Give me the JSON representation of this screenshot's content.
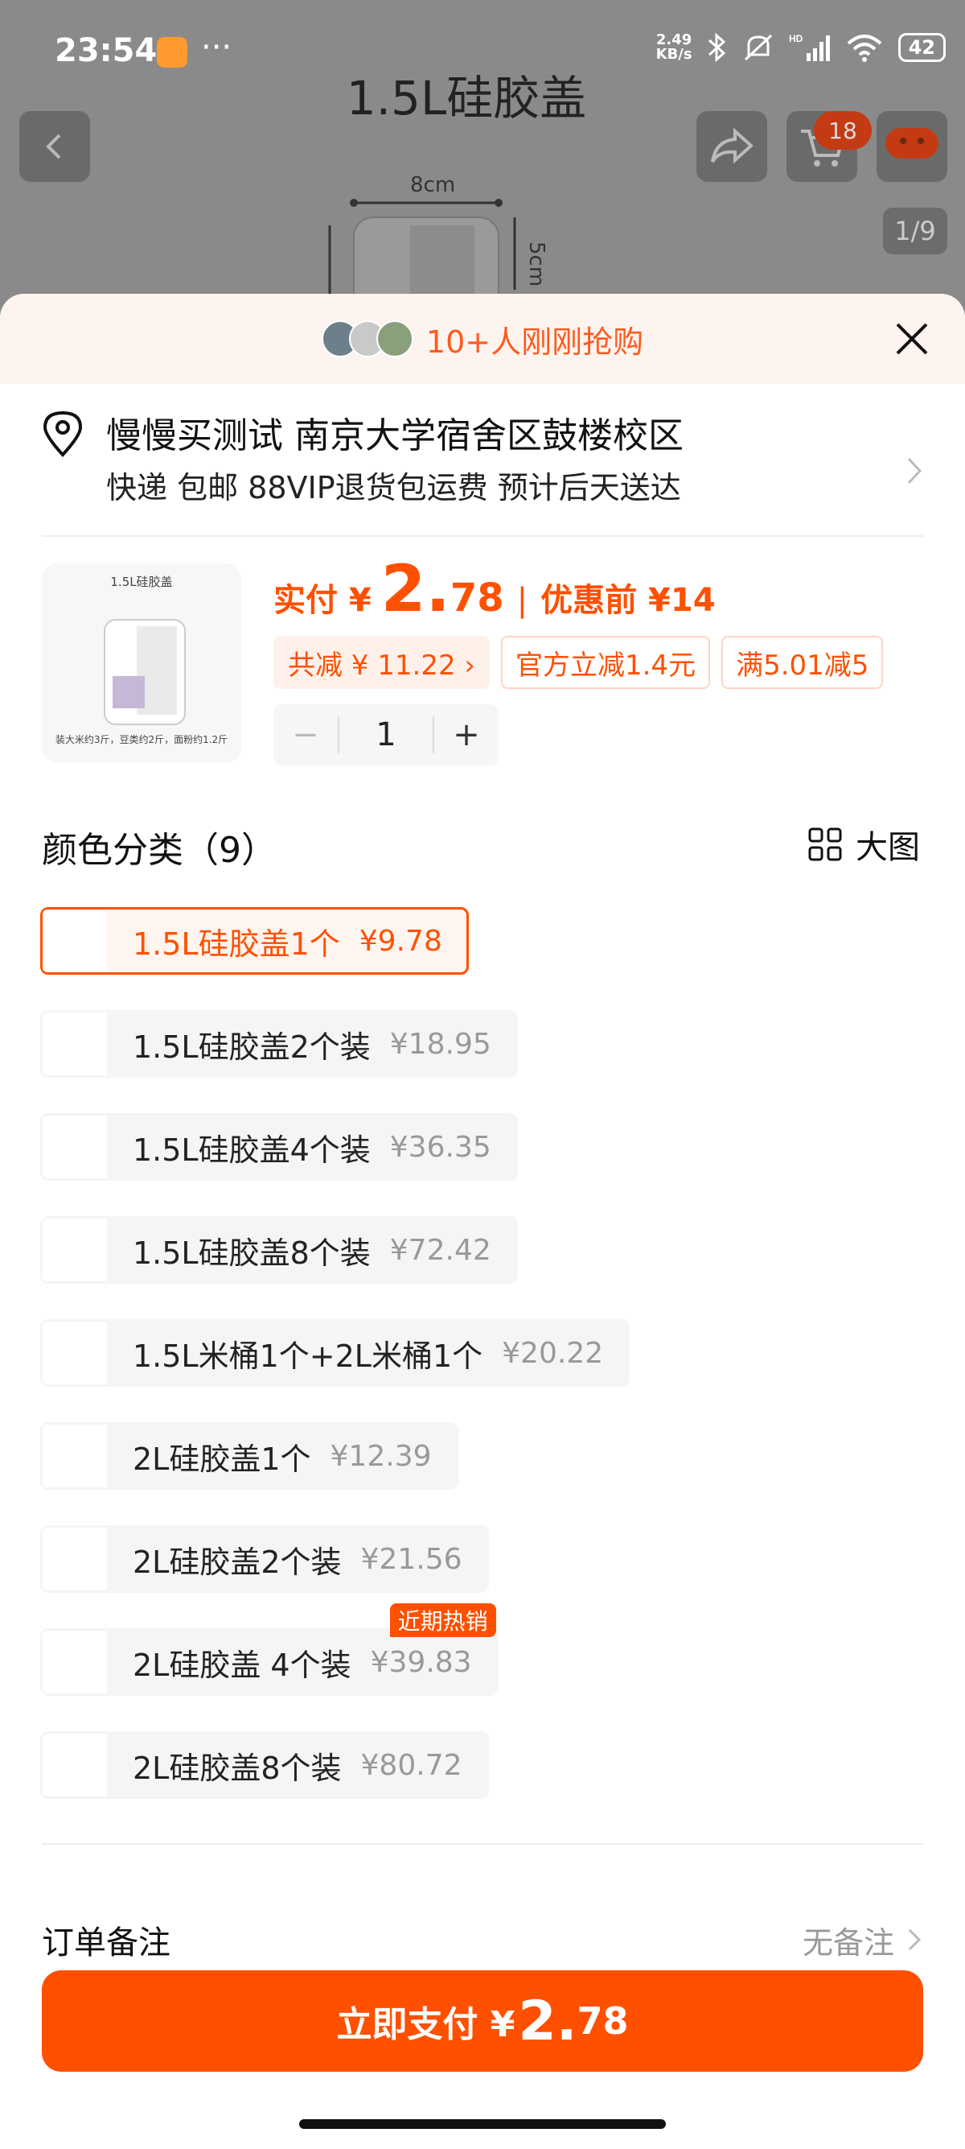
{
  "status_bar": {
    "time": "23:54",
    "dots": "···",
    "net_speed_top": "2.49",
    "net_speed_bottom": "KB/s",
    "battery": "42"
  },
  "background": {
    "title": "1.5L硅胶盖",
    "cart_count": "18",
    "image_counter": "1/9",
    "dim_width": "8cm",
    "dim_height": "5cm"
  },
  "promo": {
    "text": "10+人刚刚抢购"
  },
  "address": {
    "line1": "慢慢买测试 南京大学宿舍区鼓楼校区",
    "line2": "快递 包邮 88VIP退货包运费 预计后天送达"
  },
  "price": {
    "label": "实付 ¥",
    "int": "2.",
    "dec": "78",
    "separator": "|",
    "before": "优惠前 ¥14"
  },
  "thumb": {
    "caption": "1.5L硅胶盖",
    "footer": "装大米约3斤，豆类约2斤，面粉约1.2斤"
  },
  "tags": [
    {
      "text": "共减 ¥ 11.22 ›"
    },
    {
      "text": "官方立减1.4元"
    },
    {
      "text": "满5.01减5"
    }
  ],
  "quantity": {
    "minus": "−",
    "value": "1",
    "plus": "+"
  },
  "section": {
    "title": "颜色分类（9）",
    "bigview_label": "大图"
  },
  "skus": [
    {
      "name": "1.5L硅胶盖1个",
      "price": "¥9.78",
      "badge": ""
    },
    {
      "name": "1.5L硅胶盖2个装",
      "price": "¥18.95",
      "badge": ""
    },
    {
      "name": "1.5L硅胶盖4个装",
      "price": "¥36.35",
      "badge": ""
    },
    {
      "name": "1.5L硅胶盖8个装",
      "price": "¥72.42",
      "badge": ""
    },
    {
      "name": "1.5L米桶1个+2L米桶1个",
      "price": "¥20.22",
      "badge": ""
    },
    {
      "name": "2L硅胶盖1个",
      "price": "¥12.39",
      "badge": ""
    },
    {
      "name": "2L硅胶盖2个装",
      "price": "¥21.56",
      "badge": ""
    },
    {
      "name": "2L硅胶盖 4个装",
      "price": "¥39.83",
      "badge": "近期热销"
    },
    {
      "name": "2L硅胶盖8个装",
      "price": "¥80.72",
      "badge": ""
    }
  ],
  "selected_sku_index": 0,
  "note": {
    "label": "订单备注",
    "value": "无备注"
  },
  "pay": {
    "label": "立即支付 ¥",
    "int": "2.",
    "dec": "78"
  },
  "colors": {
    "accent": "#ff5000",
    "promo_bg": "#fef4ef"
  }
}
